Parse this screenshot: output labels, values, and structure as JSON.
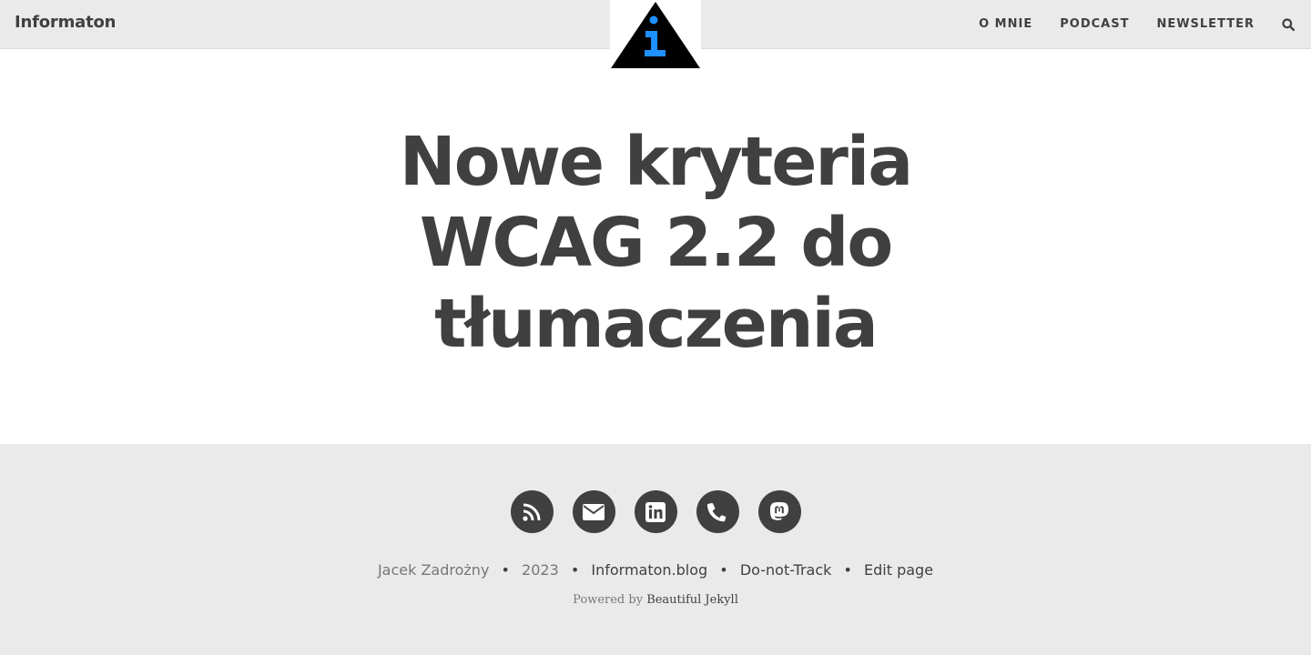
{
  "navbar": {
    "brand": "Informaton",
    "links": [
      {
        "label": "O MNIE"
      },
      {
        "label": "PODCAST"
      },
      {
        "label": "NEWSLETTER"
      }
    ],
    "search_icon": "search-icon"
  },
  "avatar": {
    "icon": "info-triangle-logo",
    "colors": {
      "triangle": "#000000",
      "glyph": "#1e90ff"
    }
  },
  "post": {
    "title": "Nowe kryteria WCAG 2.2 do tłumaczenia"
  },
  "footer": {
    "social_icons": [
      "rss-icon",
      "email-icon",
      "linkedin-icon",
      "phone-icon",
      "mastodon-icon"
    ],
    "author": "Jacek Zadrożny",
    "sep": "•",
    "year": "2023",
    "links": [
      {
        "label": "Informaton.blog"
      },
      {
        "label": "Do-not-Track"
      },
      {
        "label": "Edit page"
      }
    ],
    "powered_prefix": "Powered by",
    "powered_link": "Beautiful Jekyll"
  },
  "colors": {
    "nav_bg": "#eaeaea",
    "text": "#404040",
    "muted": "#777777",
    "accent": "#1e90ff"
  }
}
